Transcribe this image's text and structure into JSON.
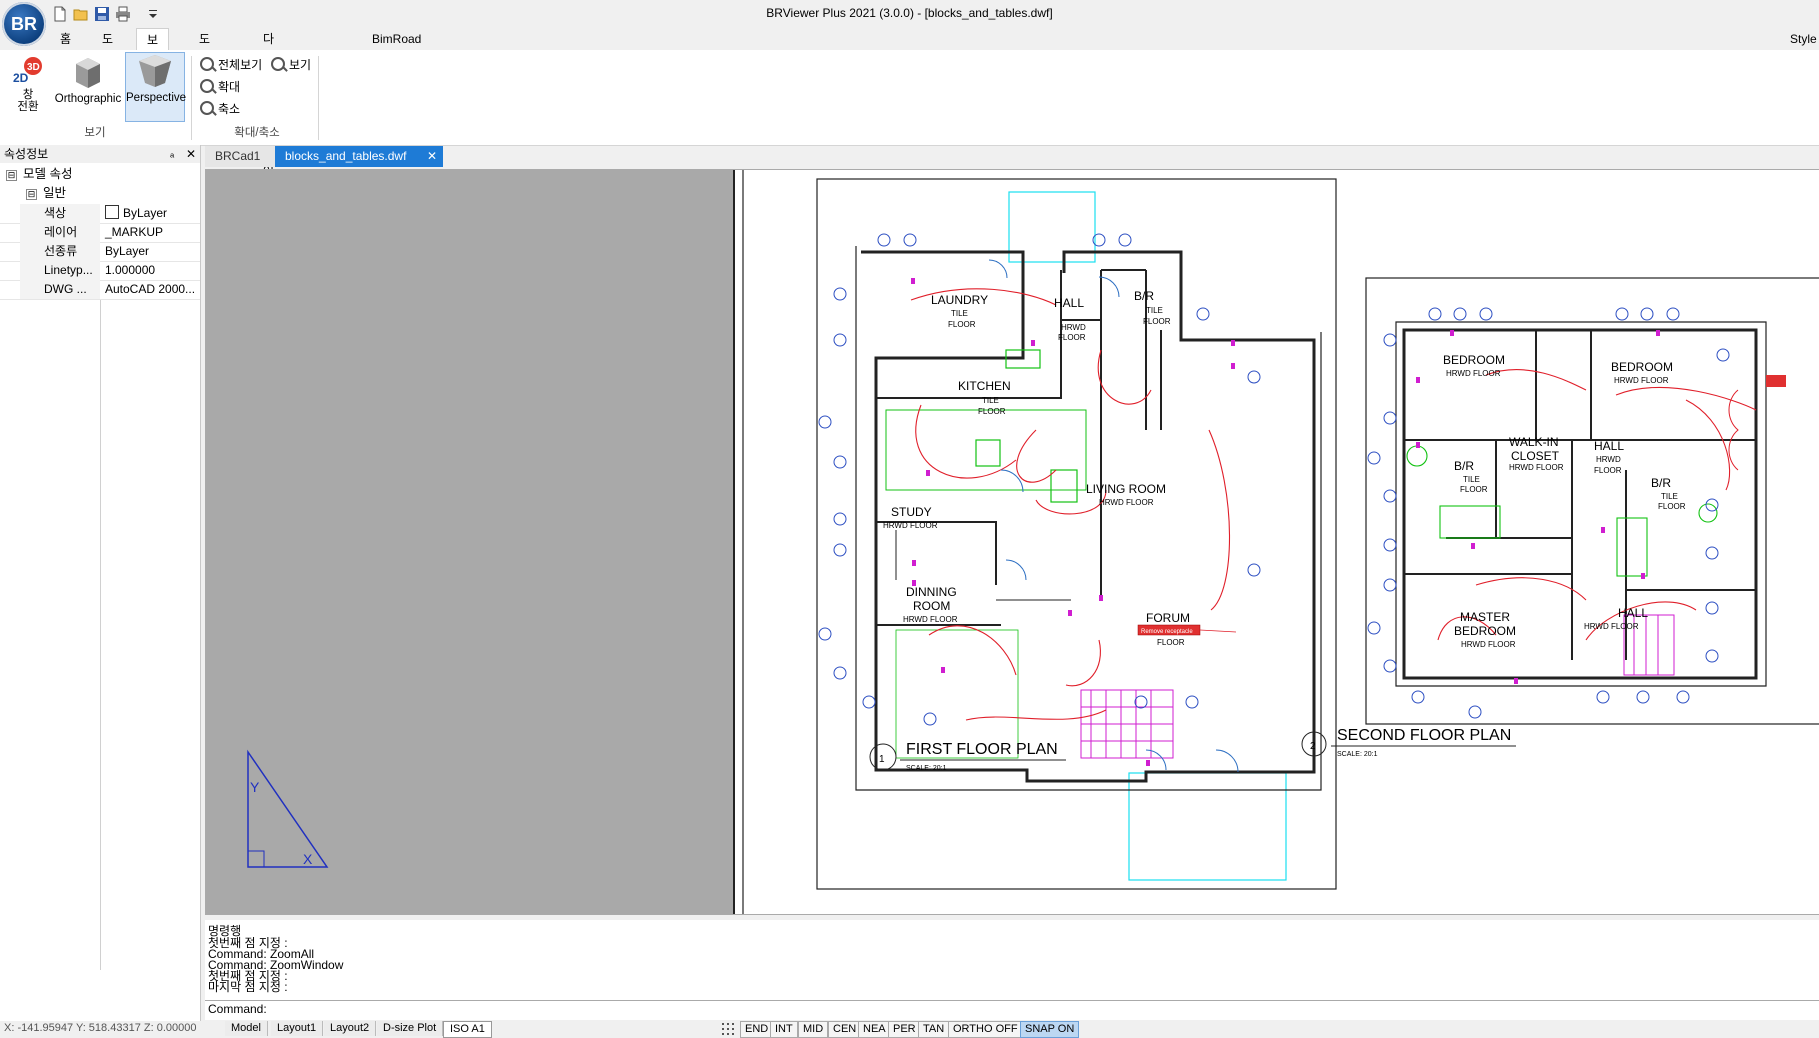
{
  "app": {
    "logo_text": "BR",
    "window_title": "BRViewer Plus 2021 (3.0.0) - [blocks_and_tables.dwf]"
  },
  "quick_access": {
    "icons": [
      "new-file-icon",
      "open-folder-icon",
      "save-icon",
      "print-icon",
      "dropdown-icon"
    ]
  },
  "ribbon": {
    "tabs": [
      {
        "label": "홈",
        "active": false
      },
      {
        "label": "도구",
        "active": false
      },
      {
        "label": "보기",
        "active": true
      },
      {
        "label": "도움말",
        "active": false
      },
      {
        "label": "다른 소프트웨어",
        "active": false
      },
      {
        "label": "BimRoad",
        "active": false
      }
    ],
    "right_label": "Style",
    "view_group": {
      "switch_label_line1": "창",
      "switch_label_line2": "전환",
      "switch_badge_3d": "3D",
      "switch_badge_2d": "2D",
      "orthographic": "Orthographic",
      "perspective": "Perspective",
      "group_label": "보기"
    },
    "zoom_group": {
      "zoom_all": "전체보기",
      "view": "보기",
      "zoom_in": "확대",
      "zoom_out": "축소",
      "group_label": "확대/축소"
    }
  },
  "properties_panel": {
    "title": "속성정보",
    "pin": "ₐ",
    "close": "✕",
    "model_section": "모델 속성",
    "general_section": "일반",
    "toggle": "⊟",
    "rows": [
      {
        "key": "색상",
        "value": "ByLayer"
      },
      {
        "key": "레이어",
        "value": "_MARKUP"
      },
      {
        "key": "선종류",
        "value": "ByLayer"
      },
      {
        "key": "Linetyp...",
        "value": "1.000000"
      },
      {
        "key": "DWG ...",
        "value": "AutoCAD 2000..."
      }
    ]
  },
  "doc_tabs": [
    {
      "label": "BRCad1",
      "active": false
    },
    {
      "label": "blocks_and_tables.dwf",
      "active": true,
      "close": "✕"
    }
  ],
  "drawing": {
    "first_floor_title": "FIRST  FLOOR  PLAN",
    "first_floor_number": "1",
    "second_floor_title": "SECOND  FLOOR  PLAN",
    "second_floor_number": "2",
    "scale": "SCALE:   20:1",
    "markup_label": "Remove receptacle",
    "ucs_y": "Y",
    "ucs_x": "X",
    "rooms_first": [
      {
        "name": "LAUNDRY",
        "floor1": "TILE",
        "floor2": "FLOOR"
      },
      {
        "name": "HALL",
        "floor1": "HRWD",
        "floor2": "FLOOR"
      },
      {
        "name": "B/R",
        "floor1": "TILE",
        "floor2": "FLOOR"
      },
      {
        "name": "KITCHEN",
        "floor1": "TILE",
        "floor2": "FLOOR"
      },
      {
        "name": "LIVING  ROOM",
        "floor1": "HRWD  FLOOR",
        "floor2": ""
      },
      {
        "name": "STUDY",
        "floor1": "HRWD  FLOOR",
        "floor2": ""
      },
      {
        "name": "DINNING",
        "floor1": "ROOM",
        "floor2": "HRWD  FLOOR"
      },
      {
        "name": "FORUM",
        "floor1": "HRWD",
        "floor2": "FLOOR"
      }
    ],
    "rooms_second": [
      {
        "name": "BEDROOM",
        "floor1": "HRWD  FLOOR"
      },
      {
        "name": "BEDROOM",
        "floor1": "HRWD  FLOOR"
      },
      {
        "name": "WALK-IN",
        "floor1": "CLOSET",
        "floor2": "HRWD  FLOOR"
      },
      {
        "name": "B/R",
        "floor1": "TILE",
        "floor2": "FLOOR"
      },
      {
        "name": "HALL",
        "floor1": "HRWD",
        "floor2": "FLOOR"
      },
      {
        "name": "B/R",
        "floor1": "TILE",
        "floor2": "FLOOR"
      },
      {
        "name": "MASTER",
        "floor1": "BEDROOM",
        "floor2": "HRWD  FLOOR"
      },
      {
        "name": "HALL",
        "floor1": "HRWD  FLOOR"
      }
    ]
  },
  "command_area": {
    "title": "명령행",
    "lines": [
      "첫번째 점 지정 :",
      "Command: ZoomAll",
      "Command: ZoomWindow",
      "첫번째 점 지정 :",
      "마지막 점 지정 :"
    ],
    "prompt": "Command:"
  },
  "status_bar": {
    "coords": "X: -141.95947  Y: 518.43317  Z: 0.00000",
    "layout_tabs": [
      {
        "label": "Model",
        "active": false
      },
      {
        "label": "Layout1",
        "active": false
      },
      {
        "label": "Layout2",
        "active": false
      },
      {
        "label": "D-size Plot",
        "active": false
      },
      {
        "label": "ISO A1",
        "active": true
      }
    ],
    "snaps": [
      {
        "label": "END",
        "active": false
      },
      {
        "label": "INT",
        "active": false
      },
      {
        "label": "MID",
        "active": false
      },
      {
        "label": "CEN",
        "active": false
      },
      {
        "label": "NEA",
        "active": false
      },
      {
        "label": "PER",
        "active": false
      },
      {
        "label": "TAN",
        "active": false
      },
      {
        "label": "ORTHO OFF",
        "active": false
      },
      {
        "label": "SNAP ON",
        "active": true
      }
    ]
  }
}
